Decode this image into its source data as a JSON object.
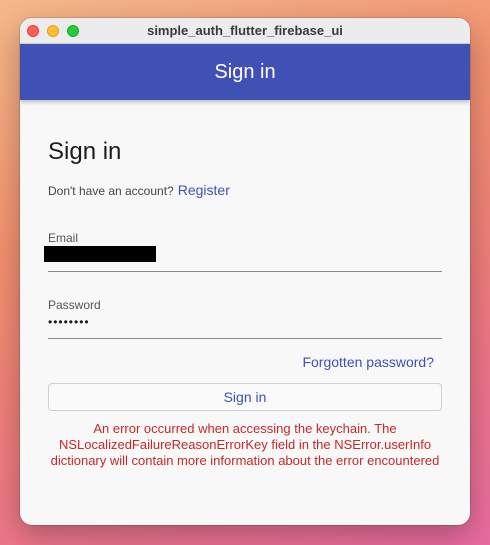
{
  "window": {
    "title": "simple_auth_flutter_firebase_ui"
  },
  "appbar": {
    "title": "Sign in"
  },
  "form": {
    "heading": "Sign in",
    "register_prompt": "Don't have an account?",
    "register_link": "Register",
    "email": {
      "label": "Email",
      "value_redacted": true
    },
    "password": {
      "label": "Password",
      "value": "••••••••"
    },
    "forgot_link": "Forgotten password?",
    "submit_label": "Sign in",
    "error_message": "An error occurred when accessing the keychain. The NSLocalizedFailureReasonErrorKey field in the NSError.userInfo dictionary will contain more information about the error encountered"
  },
  "colors": {
    "primary": "#3f51b5",
    "error": "#c62828",
    "traffic_close": "#ff5f57",
    "traffic_minimize": "#febc2e",
    "traffic_maximize": "#28c840"
  }
}
